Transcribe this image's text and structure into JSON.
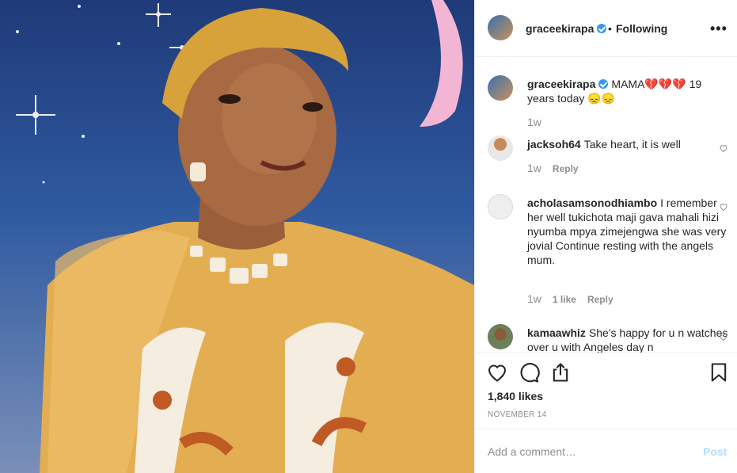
{
  "post": {
    "author": "graceekirapa",
    "follow_status": "Following",
    "more_icon": "more-horizontal-icon",
    "likes": "1,840 likes",
    "date": "NOVEMBER 14"
  },
  "caption": {
    "username": "graceekirapa",
    "text": "MAMA💔💔💔 19 years today 😞😞",
    "age": "1w"
  },
  "comments": [
    {
      "username": "jacksoh64",
      "text": "Take heart, it is well",
      "age": "1w",
      "likes": "",
      "reply": "Reply"
    },
    {
      "username": "acholasamsonodhiambo",
      "text": "I remember her well tukichota maji gava mahali hizi nyumba mpya zimejengwa she was very jovial Continue resting with the angels mum.",
      "age": "1w",
      "likes": "1 like",
      "reply": "Reply"
    },
    {
      "username": "kamaawhiz",
      "text": "She's happy for u n watches over u with Angeles day n",
      "age": "",
      "likes": "",
      "reply": ""
    }
  ],
  "add_comment": {
    "placeholder": "Add a comment…",
    "post_label": "Post"
  },
  "colors": {
    "accent": "#3897f0",
    "post_disabled": "#b2dffc",
    "muted": "#8e8e8e"
  }
}
